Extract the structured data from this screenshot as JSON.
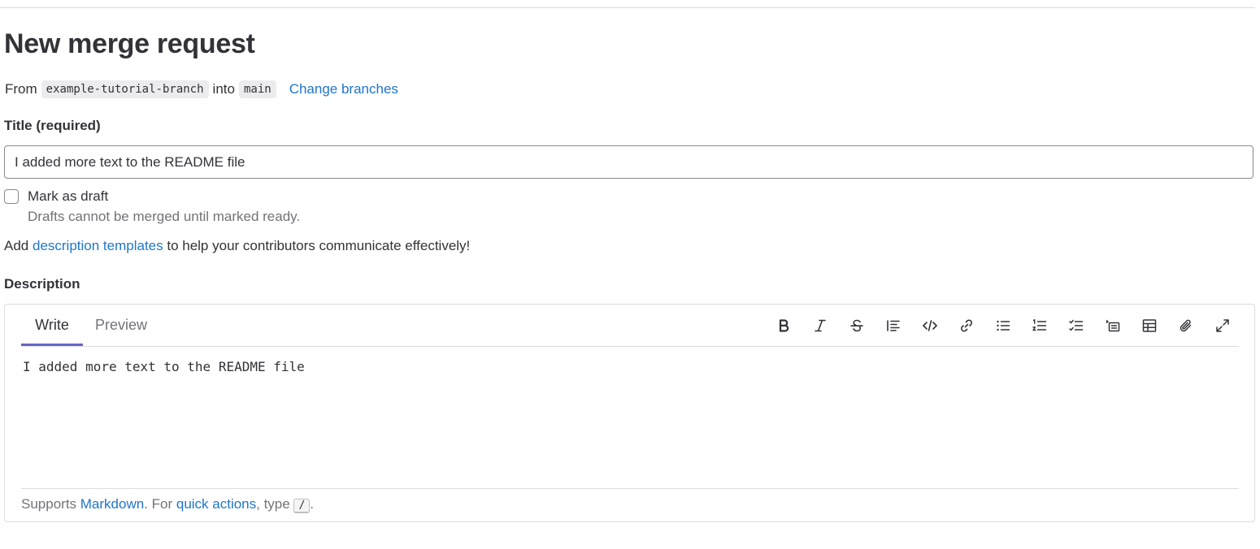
{
  "page": {
    "title": "New merge request"
  },
  "branches": {
    "from_word": "From",
    "source_branch": "example-tutorial-branch",
    "into_word": "into",
    "target_branch": "main",
    "change_link": "Change branches"
  },
  "title_field": {
    "label": "Title (required)",
    "value": "I added more text to the README file"
  },
  "draft": {
    "label": "Mark as draft",
    "help": "Drafts cannot be merged until marked ready.",
    "checked": false
  },
  "templates_hint": {
    "prefix": "Add ",
    "link": "description templates",
    "suffix": " to help your contributors communicate effectively!"
  },
  "description": {
    "label": "Description",
    "tabs": [
      {
        "label": "Write",
        "active": true
      },
      {
        "label": "Preview",
        "active": false
      }
    ],
    "toolbar_icons": [
      "bold-icon",
      "italic-icon",
      "strikethrough-icon",
      "quote-icon",
      "code-icon",
      "link-icon",
      "bulleted-list-icon",
      "numbered-list-icon",
      "task-list-icon",
      "collapsible-section-icon",
      "table-icon",
      "attach-file-icon",
      "fullscreen-icon"
    ],
    "text": "I added more text to the README file",
    "footer": {
      "prefix": "Supports ",
      "markdown_link": "Markdown",
      "middle": ". For ",
      "quick_actions_link": "quick actions",
      "type_word": ", type ",
      "kbd": "/",
      "end": "."
    }
  },
  "colors": {
    "link": "#1f75cb",
    "tab_active_underline": "#6666c4",
    "text": "#333238",
    "muted": "#737278"
  }
}
